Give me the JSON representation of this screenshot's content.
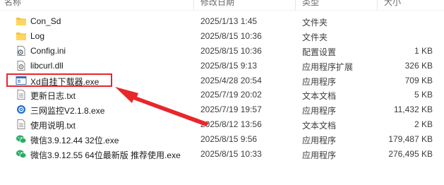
{
  "header": {
    "name": "名称",
    "date": "修改日期",
    "type": "类型",
    "size": "大小"
  },
  "files": [
    {
      "name": "Con_Sd",
      "date": "2025/1/13 1:45",
      "type": "文件夹",
      "size": "",
      "icon": "folder-icon"
    },
    {
      "name": "Log",
      "date": "2025/8/15 10:36",
      "type": "文件夹",
      "size": "",
      "icon": "folder-icon"
    },
    {
      "name": "Config.ini",
      "date": "2025/8/15 10:36",
      "type": "配置设置",
      "size": "1 KB",
      "icon": "settings-file-icon"
    },
    {
      "name": "libcurl.dll",
      "date": "2025/8/15 9:13",
      "type": "应用程序扩展",
      "size": "326 KB",
      "icon": "dll-file-icon"
    },
    {
      "name": "Xd自挂下载器.exe",
      "date": "2025/4/28 20:54",
      "type": "应用程序",
      "size": "709 KB",
      "icon": "window-app-icon"
    },
    {
      "name": "更新日志.txt",
      "date": "2025/7/19 20:02",
      "type": "文本文档",
      "size": "5 KB",
      "icon": "text-file-icon"
    },
    {
      "name": "三网监控V2.1.8.exe",
      "date": "2025/7/19 19:57",
      "type": "应用程序",
      "size": "11,432 KB",
      "icon": "blue-app-icon"
    },
    {
      "name": "使用说明.txt",
      "date": "2025/8/12 13:56",
      "type": "文本文档",
      "size": "2 KB",
      "icon": "text-file-icon"
    },
    {
      "name": "微信3.9.12.44 32位.exe",
      "date": "2025/8/15 9:56",
      "type": "应用程序",
      "size": "179,487 KB",
      "icon": "wechat-icon"
    },
    {
      "name": "微信3.9.12.55 64位最新版 推荐使用.exe",
      "date": "2025/8/15 10:33",
      "type": "应用程序",
      "size": "276,495 KB",
      "icon": "wechat-icon"
    }
  ],
  "annotation": {
    "color": "#e8262b",
    "target": "Xd自挂下载器.exe"
  }
}
